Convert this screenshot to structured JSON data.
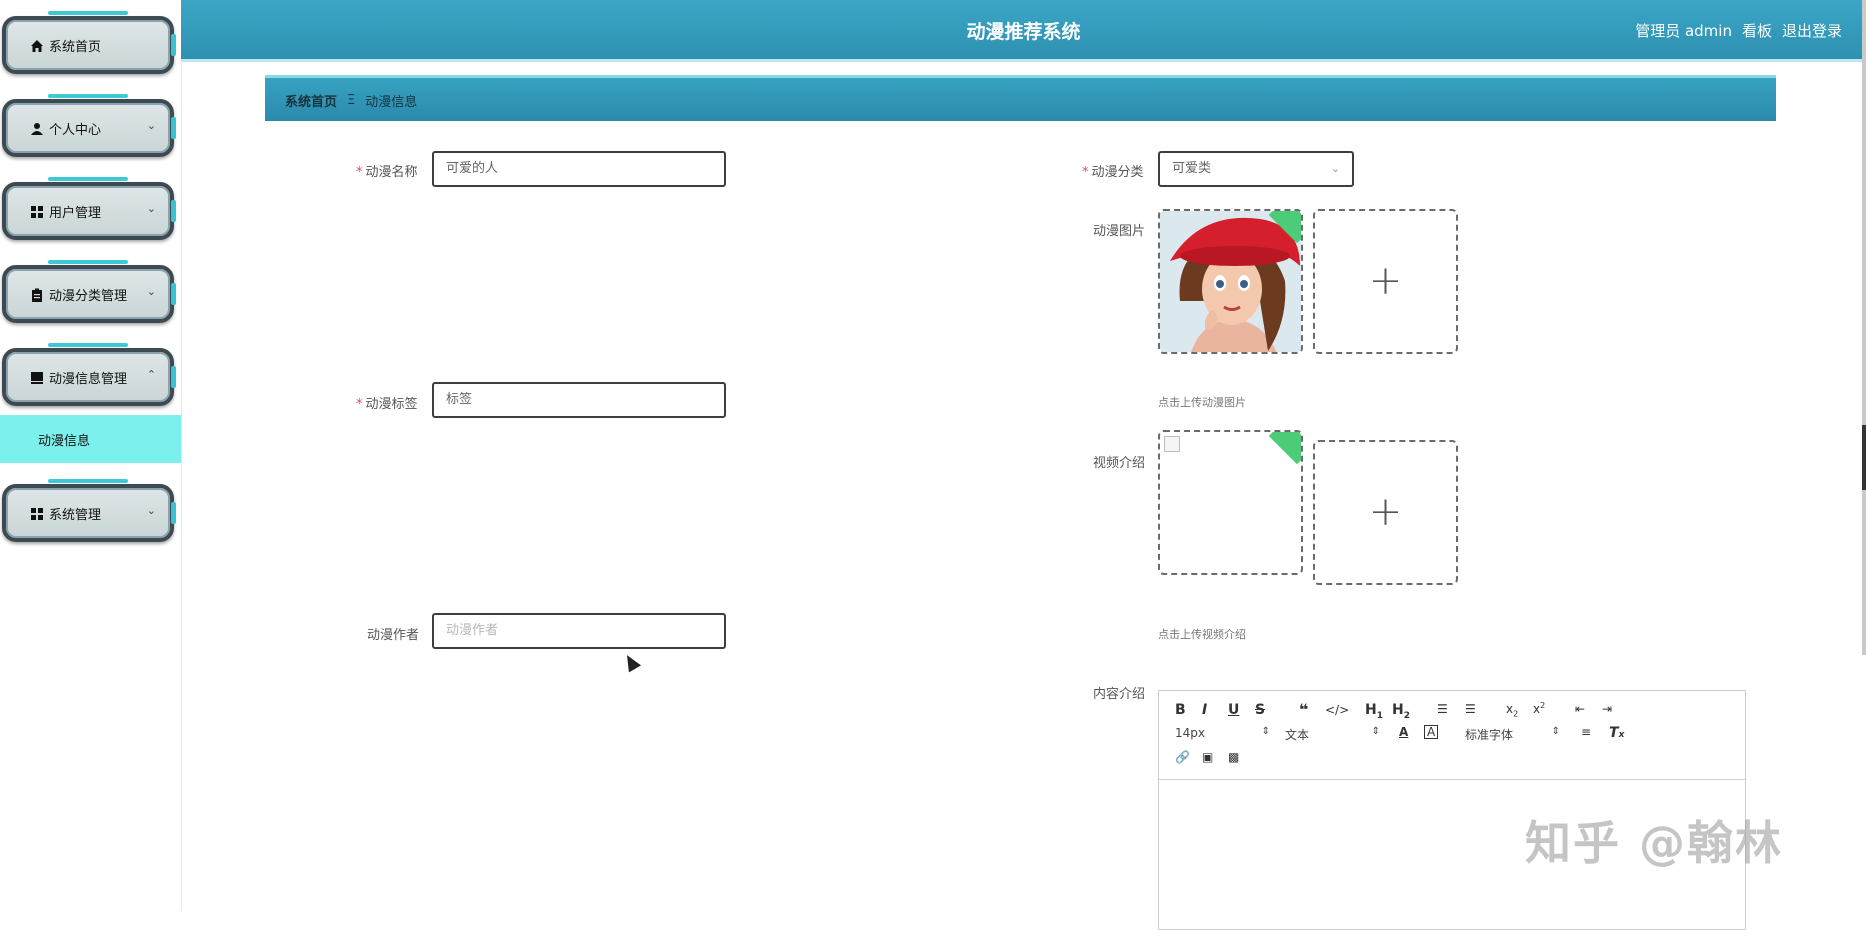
{
  "header": {
    "title": "动漫推荐系统",
    "user_label": "管理员 admin",
    "dashboard_link": "看板",
    "logout_link": "退出登录"
  },
  "sidebar": {
    "items": [
      {
        "label": "系统首页",
        "icon": "home-icon"
      },
      {
        "label": "个人中心",
        "icon": "user-icon",
        "chevron": "⌄"
      },
      {
        "label": "用户管理",
        "icon": "grid-icon",
        "chevron": "⌄"
      },
      {
        "label": "动漫分类管理",
        "icon": "clipboard-icon",
        "chevron": "⌄"
      },
      {
        "label": "动漫信息管理",
        "icon": "book-icon",
        "chevron": "⌃"
      },
      {
        "label": "系统管理",
        "icon": "grid-icon",
        "chevron": "⌄"
      }
    ],
    "submenu_active": "动漫信息"
  },
  "breadcrumb": {
    "home": "系统首页",
    "separator": "Ξ",
    "current": "动漫信息"
  },
  "form": {
    "name_label": "动漫名称",
    "name_value": "可爱的人",
    "tag_label": "动漫标签",
    "tag_value": "标签",
    "author_label": "动漫作者",
    "author_placeholder": "动漫作者",
    "category_label": "动漫分类",
    "category_value": "可爱类",
    "image_label": "动漫图片",
    "image_hint": "点击上传动漫图片",
    "video_label": "视频介绍",
    "video_hint": "点击上传视频介绍",
    "content_label": "内容介绍",
    "required_mark": "*",
    "plus": "+"
  },
  "editor": {
    "font_size": "14px",
    "header_select": "文本",
    "font_family": "标准字体",
    "spinner": "⇕"
  },
  "watermark": "知乎 @翰林",
  "colors": {
    "header": "#3ba6c6",
    "submenu_active": "#7cf0ec",
    "required": "#e84b4b",
    "upload_corner": "#4ccb79"
  }
}
